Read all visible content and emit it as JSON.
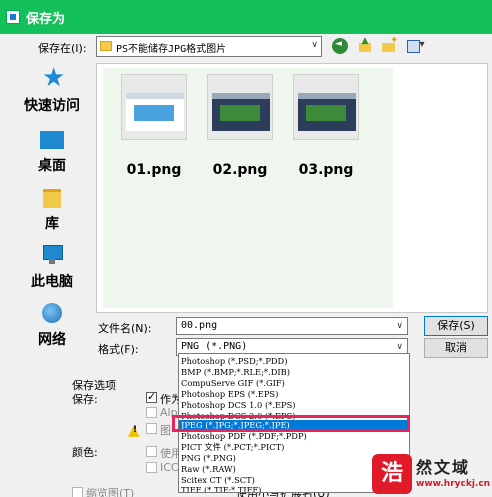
{
  "window": {
    "title": "保存为",
    "accent": "#14c05a"
  },
  "toolbar": {
    "save_in_label": "保存在(I):",
    "save_in_value": "PS不能储存JPG格式图片",
    "icons": [
      "back-icon",
      "up-folder-icon",
      "new-folder-icon",
      "view-menu-icon"
    ]
  },
  "places": [
    {
      "label": "快速访问",
      "icon": "star-icon"
    },
    {
      "label": "桌面",
      "icon": "desktop-icon"
    },
    {
      "label": "库",
      "icon": "library-icon"
    },
    {
      "label": "此电脑",
      "icon": "computer-icon"
    },
    {
      "label": "网络",
      "icon": "network-icon"
    }
  ],
  "files": [
    {
      "name": "01.png"
    },
    {
      "name": "02.png"
    },
    {
      "name": "03.png"
    }
  ],
  "filename": {
    "label": "文件名(N):",
    "value": "00.png"
  },
  "format": {
    "label": "格式(F):",
    "value": "PNG (*.PNG)",
    "options": [
      "Photoshop (*.PSD;*.PDD)",
      "BMP (*.BMP;*.RLE;*.DIB)",
      "CompuServe GIF (*.GIF)",
      "Photoshop EPS (*.EPS)",
      "Photoshop DCS 1.0 (*.EPS)",
      "Photoshop DCS 2.0 (*.EPS)",
      "JPEG (*.JPG;*.JPEG;*.JPE)",
      "Photoshop PDF (*.PDF;*.PDP)",
      "PICT 文件 (*.PCT;*.PICT)",
      "PNG (*.PNG)",
      "Raw (*.RAW)",
      "Scitex CT (*.SCT)",
      "TIFF (*.TIF;*.TIFF)"
    ],
    "selected_option": "JPEG (*.JPG;*.JPEG;*.JPE)",
    "highlight_color": "#e8245b"
  },
  "buttons": {
    "save": "保存(S)",
    "cancel": "取消"
  },
  "save_options": {
    "section_title": "保存选项",
    "save_label": "保存:",
    "as_copy": "作为",
    "alpha": "Alp",
    "annotation": "图",
    "color_label": "颜色:",
    "use_proof": "使用",
    "icc": "ICC",
    "thumbnail": "缩览图(T)",
    "lowercase_ext": "使用小写扩展名(U)"
  },
  "watermark": {
    "badge": "浩",
    "text": "然文域",
    "url": "www.hryckj.cn"
  }
}
